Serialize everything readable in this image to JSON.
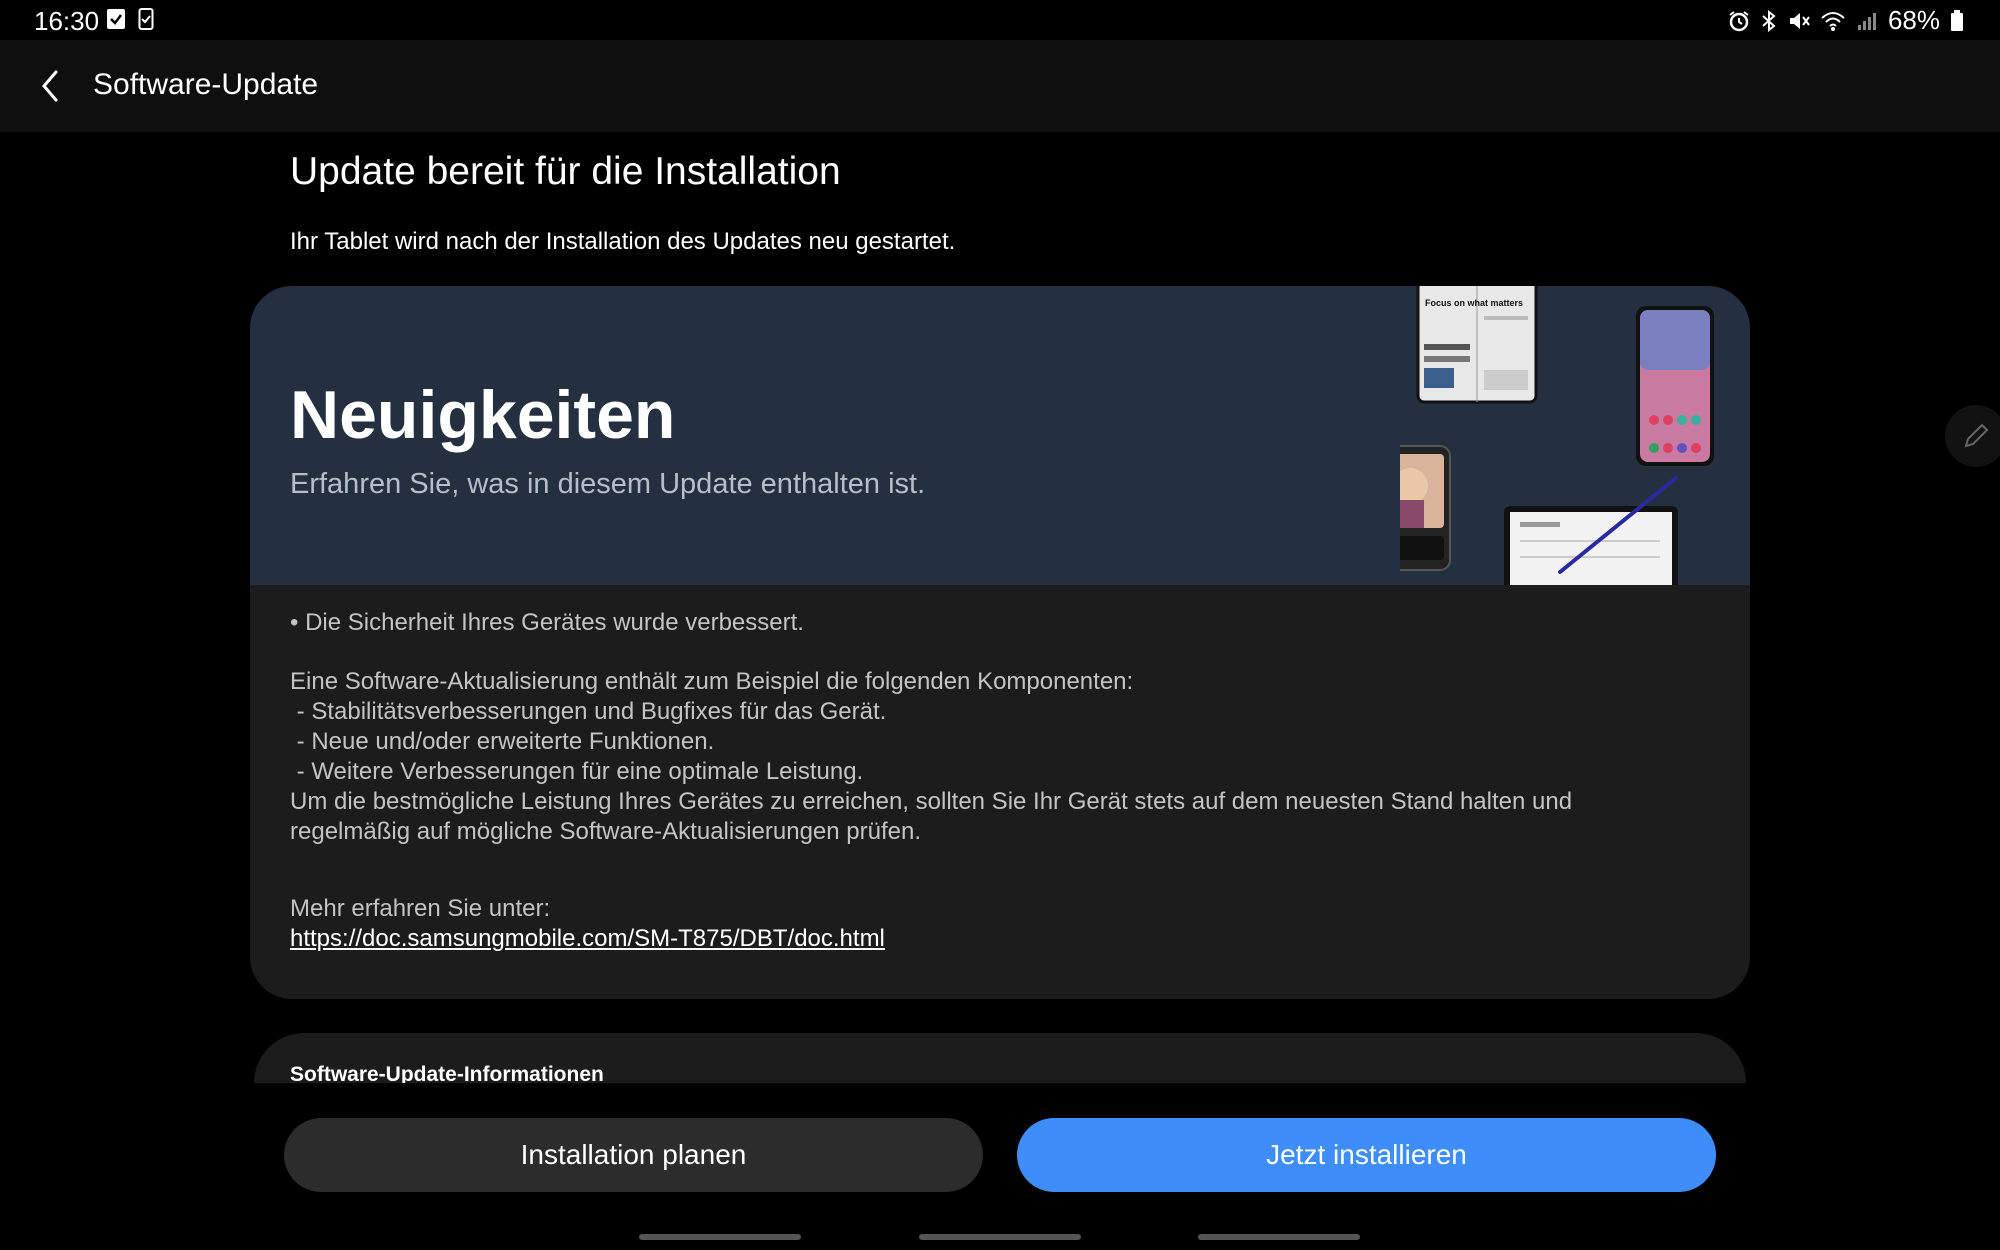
{
  "status_bar": {
    "time": "16:30",
    "battery": "68%",
    "icons": [
      "check-notification-icon",
      "phone-notification-icon",
      "alarm-icon",
      "bluetooth-icon",
      "mute-icon",
      "wifi-icon",
      "signal-icon",
      "battery-icon"
    ]
  },
  "appbar": {
    "title": "Software-Update"
  },
  "header": {
    "title": "Update bereit für die Installation",
    "subtitle": "Ihr Tablet wird nach der Installation des Updates neu gestartet."
  },
  "card": {
    "banner_title": "Neuigkeiten",
    "banner_subtitle": "Erfahren Sie, was in diesem Update enthalten ist.",
    "bullet": "• Die Sicherheit Ihres Gerätes wurde verbessert.",
    "intro": "Eine Software-Aktualisierung enthält zum Beispiel die folgenden Komponenten:",
    "items": [
      " - Stabilitätsverbesserungen und Bugfixes für das Gerät.",
      " - Neue und/oder erweiterte Funktionen.",
      " - Weitere Verbesserungen für eine optimale Leistung."
    ],
    "advice_line1": "Um die bestmögliche Leistung Ihres Gerätes zu erreichen, sollten Sie Ihr Gerät stets auf dem neuesten Stand halten und",
    "advice_line2": "regelmäßig auf mögliche Software-Aktualisierungen prüfen.",
    "more_label": "Mehr erfahren Sie unter:",
    "more_link": "https://doc.samsungmobile.com/SM-T875/DBT/doc.html",
    "art_text": "Focus on what matters"
  },
  "info_section": {
    "title": "Software-Update-Informationen"
  },
  "buttons": {
    "schedule": "Installation planen",
    "install": "Jetzt installieren"
  },
  "colors": {
    "accent": "#3e8dfa",
    "banner_bg": "#243040",
    "card_bg": "#1c1c1c"
  }
}
